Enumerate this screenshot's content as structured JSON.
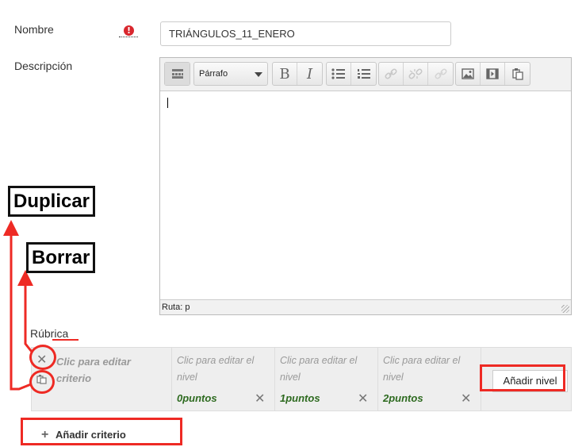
{
  "form": {
    "name_label": "Nombre",
    "required_glyph": "!",
    "name_value": "TRIÁNGULOS_11_ENERO",
    "description_label": "Descripción"
  },
  "editor": {
    "format_select": "Párrafo",
    "status_path": "Ruta: p",
    "toolbar_icons": [
      "toolbar-toggle-icon",
      "bold-icon",
      "italic-icon",
      "bullet-list-icon",
      "numbered-list-icon",
      "link-icon",
      "unlink-icon",
      "nolink-icon",
      "image-icon",
      "media-icon",
      "manage-files-icon"
    ],
    "bold_glyph": "B",
    "italic_glyph": "I"
  },
  "rubric": {
    "label": "Rúbrica",
    "criterion_placeholder": "Clic para editar criterio",
    "delete_glyph": "✕",
    "levels": [
      {
        "placeholder": "Clic para editar el nivel",
        "points": "0puntos"
      },
      {
        "placeholder": "Clic para editar el nivel",
        "points": "1puntos"
      },
      {
        "placeholder": "Clic para editar el nivel",
        "points": "2puntos"
      }
    ],
    "add_level": "Añadir nivel",
    "add_criterion": "Añadir criterio",
    "add_glyph": "+"
  },
  "annotations": {
    "duplicate": "Duplicar",
    "delete": "Borrar",
    "color": "#ee2a24"
  }
}
